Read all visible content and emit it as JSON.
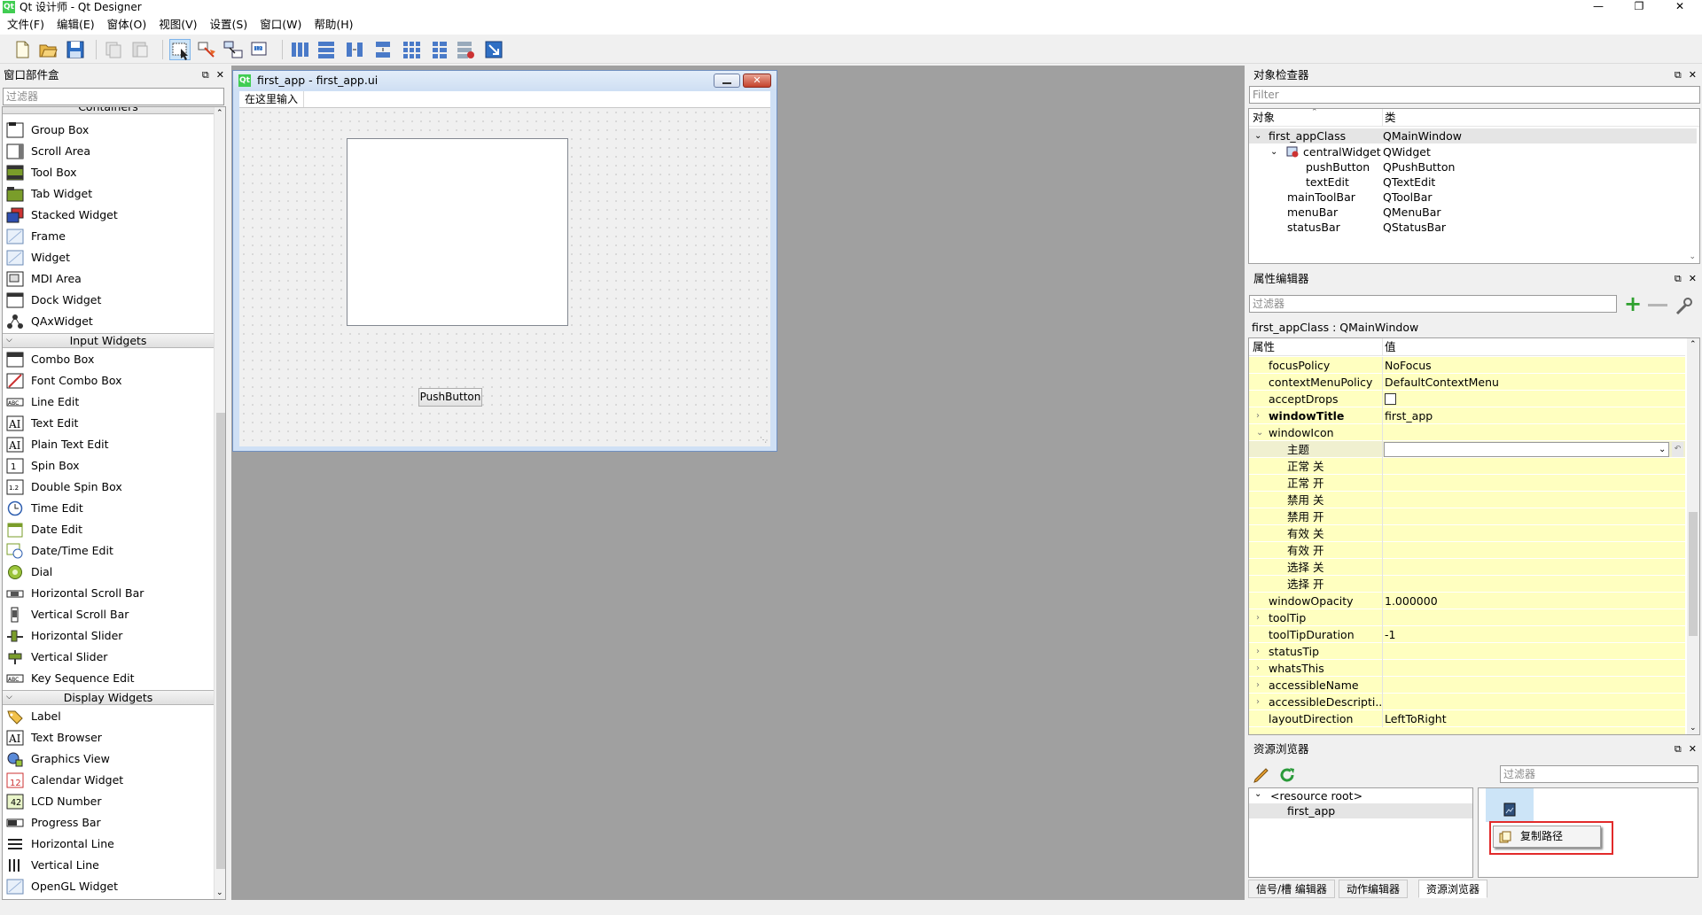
{
  "app": {
    "title": "Qt 设计师 - Qt Designer",
    "qt_logo": "Qt"
  },
  "menu": [
    "文件(F)",
    "编辑(E)",
    "窗体(O)",
    "视图(V)",
    "设置(S)",
    "窗口(W)",
    "帮助(H)"
  ],
  "toolbar_icons": [
    "new-file-icon",
    "open-folder-icon",
    "save-icon",
    "copy-disabled-icon",
    "paste-disabled-icon",
    "edit-widgets-icon",
    "edit-signals-slots-icon",
    "edit-buddies-icon",
    "edit-tab-order-icon",
    "layout-horizontal-icon",
    "layout-vertical-icon",
    "layout-horizontal-splitter-icon",
    "layout-vertical-splitter-icon",
    "layout-grid-icon",
    "layout-form-icon",
    "break-layout-icon",
    "adjust-size-icon"
  ],
  "widget_box": {
    "title": "窗口部件盒",
    "filter_placeholder": "过滤器",
    "partial_category": "Containers",
    "containers": [
      "Group Box",
      "Scroll Area",
      "Tool Box",
      "Tab Widget",
      "Stacked Widget",
      "Frame",
      "Widget",
      "MDI Area",
      "Dock Widget",
      "QAxWidget"
    ],
    "input_category": "Input Widgets",
    "inputs": [
      "Combo Box",
      "Font Combo Box",
      "Line Edit",
      "Text Edit",
      "Plain Text Edit",
      "Spin Box",
      "Double Spin Box",
      "Time Edit",
      "Date Edit",
      "Date/Time Edit",
      "Dial",
      "Horizontal Scroll Bar",
      "Vertical Scroll Bar",
      "Horizontal Slider",
      "Vertical Slider",
      "Key Sequence Edit"
    ],
    "display_category": "Display Widgets",
    "displays": [
      "Label",
      "Text Browser",
      "Graphics View",
      "Calendar Widget",
      "LCD Number",
      "Progress Bar",
      "Horizontal Line",
      "Vertical Line",
      "OpenGL Widget"
    ]
  },
  "form": {
    "title": "first_app - first_app.ui",
    "menu_placeholder": "在这里输入",
    "push_button": "PushButton"
  },
  "object_inspector": {
    "title": "对象检查器",
    "filter_placeholder": "Filter",
    "col_object": "对象",
    "col_class": "类",
    "rows": [
      {
        "name": "first_appClass",
        "cls": "QMainWindow"
      },
      {
        "name": "centralWidget",
        "cls": "QWidget"
      },
      {
        "name": "pushButton",
        "cls": "QPushButton"
      },
      {
        "name": "textEdit",
        "cls": "QTextEdit"
      },
      {
        "name": "mainToolBar",
        "cls": "QToolBar"
      },
      {
        "name": "menuBar",
        "cls": "QMenuBar"
      },
      {
        "name": "statusBar",
        "cls": "QStatusBar"
      }
    ]
  },
  "property_editor": {
    "title": "属性编辑器",
    "filter_placeholder": "过滤器",
    "context": "first_appClass : QMainWindow",
    "col_property": "属性",
    "col_value": "值",
    "rows": [
      {
        "name": "focusPolicy",
        "value": "NoFocus"
      },
      {
        "name": "contextMenuPolicy",
        "value": "DefaultContextMenu"
      },
      {
        "name": "acceptDrops",
        "value": ""
      },
      {
        "name": "windowTitle",
        "value": "first_app"
      },
      {
        "name": "windowIcon",
        "value": ""
      },
      {
        "name": "主题",
        "value": ""
      },
      {
        "name": "正常 关",
        "value": ""
      },
      {
        "name": "正常 开",
        "value": ""
      },
      {
        "name": "禁用 关",
        "value": ""
      },
      {
        "name": "禁用 开",
        "value": ""
      },
      {
        "name": "有效 关",
        "value": ""
      },
      {
        "name": "有效 开",
        "value": ""
      },
      {
        "name": "选择 关",
        "value": ""
      },
      {
        "name": "选择 开",
        "value": ""
      },
      {
        "name": "windowOpacity",
        "value": "1.000000"
      },
      {
        "name": "toolTip",
        "value": ""
      },
      {
        "name": "toolTipDuration",
        "value": "-1"
      },
      {
        "name": "statusTip",
        "value": ""
      },
      {
        "name": "whatsThis",
        "value": ""
      },
      {
        "name": "accessibleName",
        "value": ""
      },
      {
        "name": "accessibleDescripti...",
        "value": ""
      },
      {
        "name": "layoutDirection",
        "value": "LeftToRight"
      }
    ]
  },
  "resource_browser": {
    "title": "资源浏览器",
    "filter_placeholder": "过滤器",
    "root": "<resource root>",
    "child": "first_app",
    "context_item": "复制路径"
  },
  "bottom_tabs": [
    "信号/槽 编辑器",
    "动作编辑器",
    "资源浏览器"
  ]
}
